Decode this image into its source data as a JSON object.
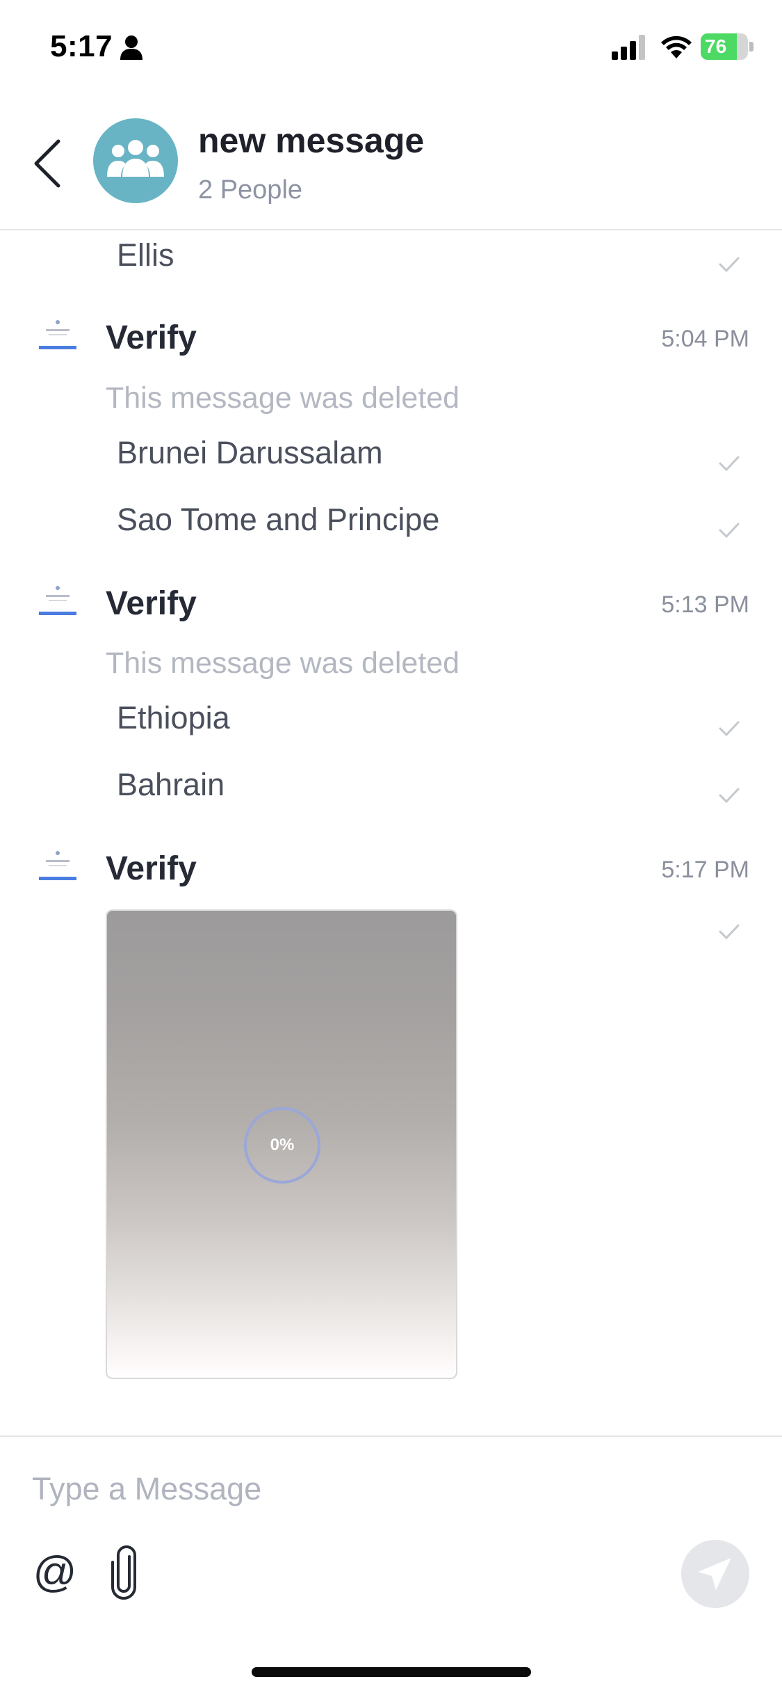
{
  "status_bar": {
    "time": "5:17",
    "battery_level": "76",
    "battery_fraction": 0.76
  },
  "header": {
    "title": "new message",
    "subtitle": "2 People",
    "avatar_icon": "group-icon"
  },
  "messages": [
    {
      "lines": [
        "Ellis"
      ]
    },
    {
      "sender": "Verify",
      "time": "5:04 PM",
      "deleted_text": "This message was deleted",
      "lines": [
        "Brunei Darussalam",
        "Sao Tome and Principe"
      ]
    },
    {
      "sender": "Verify",
      "time": "5:13 PM",
      "deleted_text": "This message was deleted",
      "lines": [
        "Ethiopia",
        "Bahrain"
      ]
    },
    {
      "sender": "Verify",
      "time": "5:17 PM",
      "image_progress": "0%"
    }
  ],
  "composer": {
    "placeholder": "Type a Message",
    "mention_symbol": "@"
  },
  "colors": {
    "avatar": "#68b4c4",
    "battery_fill": "#4cd964",
    "deleted_text": "#b3b7c1",
    "send_button": "#e4e6ea"
  }
}
